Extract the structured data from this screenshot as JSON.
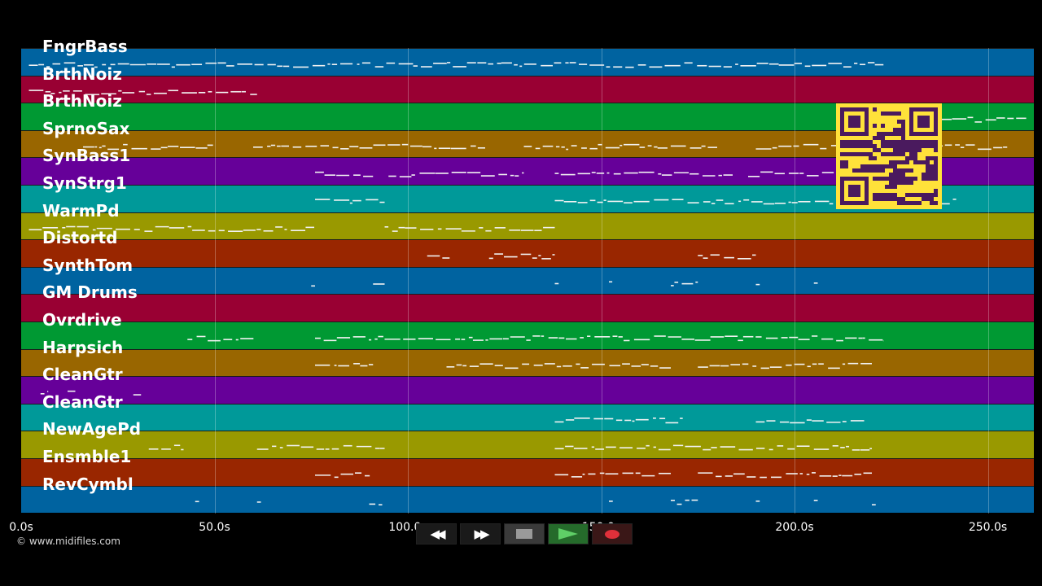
{
  "tracks": [
    {
      "name": "FngrBass",
      "color": "#0063a0"
    },
    {
      "name": "BrthNoiz",
      "color": "#990033"
    },
    {
      "name": "BrthNoiz",
      "color": "#009933"
    },
    {
      "name": "SprnoSax",
      "color": "#996600"
    },
    {
      "name": "SynBass1",
      "color": "#660099"
    },
    {
      "name": "SynStrg1",
      "color": "#009999"
    },
    {
      "name": "WarmPd",
      "color": "#999900"
    },
    {
      "name": "Distortd",
      "color": "#992600"
    },
    {
      "name": "SynthTom",
      "color": "#0063a0"
    },
    {
      "name": "GM Drums",
      "color": "#990033"
    },
    {
      "name": "Ovrdrive",
      "color": "#009933"
    },
    {
      "name": "Harpsich",
      "color": "#996600"
    },
    {
      "name": "CleanGtr",
      "color": "#660099"
    },
    {
      "name": "CleanGtr",
      "color": "#009999"
    },
    {
      "name": "NewAgePd",
      "color": "#999900"
    },
    {
      "name": "Ensmble1",
      "color": "#992600"
    },
    {
      "name": "RevCymbl",
      "color": "#0063a0"
    }
  ],
  "timeline": {
    "ticks": [
      "0.0s",
      "50.0s",
      "100.0s",
      "150.0s",
      "200.0s",
      "250.0s"
    ],
    "tick_values": [
      0,
      50,
      100,
      150,
      200,
      250
    ],
    "max_seconds": 262
  },
  "notes": [
    {
      "track": 0,
      "segments": [
        [
          2,
          223
        ]
      ]
    },
    {
      "track": 1,
      "segments": [
        [
          2,
          61
        ]
      ]
    },
    {
      "track": 2,
      "segments": [
        [
          237,
          260
        ]
      ]
    },
    {
      "track": 3,
      "segments": [
        [
          16,
          50
        ],
        [
          60,
          120
        ],
        [
          130,
          180
        ],
        [
          190,
          255
        ]
      ]
    },
    {
      "track": 4,
      "segments": [
        [
          76,
          91
        ],
        [
          95,
          130
        ],
        [
          138,
          184
        ],
        [
          188,
          230
        ]
      ]
    },
    {
      "track": 5,
      "segments": [
        [
          76,
          94
        ],
        [
          138,
          242
        ]
      ]
    },
    {
      "track": 6,
      "segments": [
        [
          2,
          76
        ],
        [
          94,
          138
        ]
      ]
    },
    {
      "track": 7,
      "segments": [
        [
          105,
          111
        ],
        [
          121,
          138
        ],
        [
          175,
          190
        ]
      ]
    },
    {
      "track": 8,
      "segments": [
        [
          75,
          76
        ],
        [
          91,
          94
        ],
        [
          138,
          139
        ],
        [
          152,
          153
        ],
        [
          168,
          175
        ],
        [
          190,
          191
        ],
        [
          205,
          206
        ]
      ]
    },
    {
      "track": 10,
      "segments": [
        [
          43,
          61
        ],
        [
          76,
          223
        ]
      ]
    },
    {
      "track": 11,
      "segments": [
        [
          76,
          91
        ],
        [
          110,
          168
        ],
        [
          175,
          220
        ]
      ]
    },
    {
      "track": 12,
      "segments": [
        [
          5,
          7
        ],
        [
          12,
          14
        ],
        [
          29,
          31
        ]
      ]
    },
    {
      "track": 13,
      "segments": [
        [
          138,
          172
        ],
        [
          190,
          218
        ]
      ]
    },
    {
      "track": 14,
      "segments": [
        [
          33,
          42
        ],
        [
          61,
          94
        ],
        [
          138,
          220
        ]
      ]
    },
    {
      "track": 15,
      "segments": [
        [
          76,
          91
        ],
        [
          138,
          168
        ],
        [
          175,
          220
        ]
      ]
    },
    {
      "track": 16,
      "segments": [
        [
          45,
          46
        ],
        [
          61,
          62
        ],
        [
          90,
          94
        ],
        [
          152,
          153
        ],
        [
          168,
          175
        ],
        [
          190,
          191
        ],
        [
          205,
          206
        ],
        [
          220,
          221
        ]
      ]
    }
  ],
  "copyright": "© www.midifiles.com",
  "transport": {
    "rewind_icon": "rewind-icon",
    "forward_icon": "fast-forward-icon",
    "stop_icon": "stop-icon",
    "play_icon": "play-icon",
    "record_icon": "record-icon"
  },
  "qr_code": {
    "fg": "#4a1a5e",
    "bg": "#ffe23a"
  }
}
